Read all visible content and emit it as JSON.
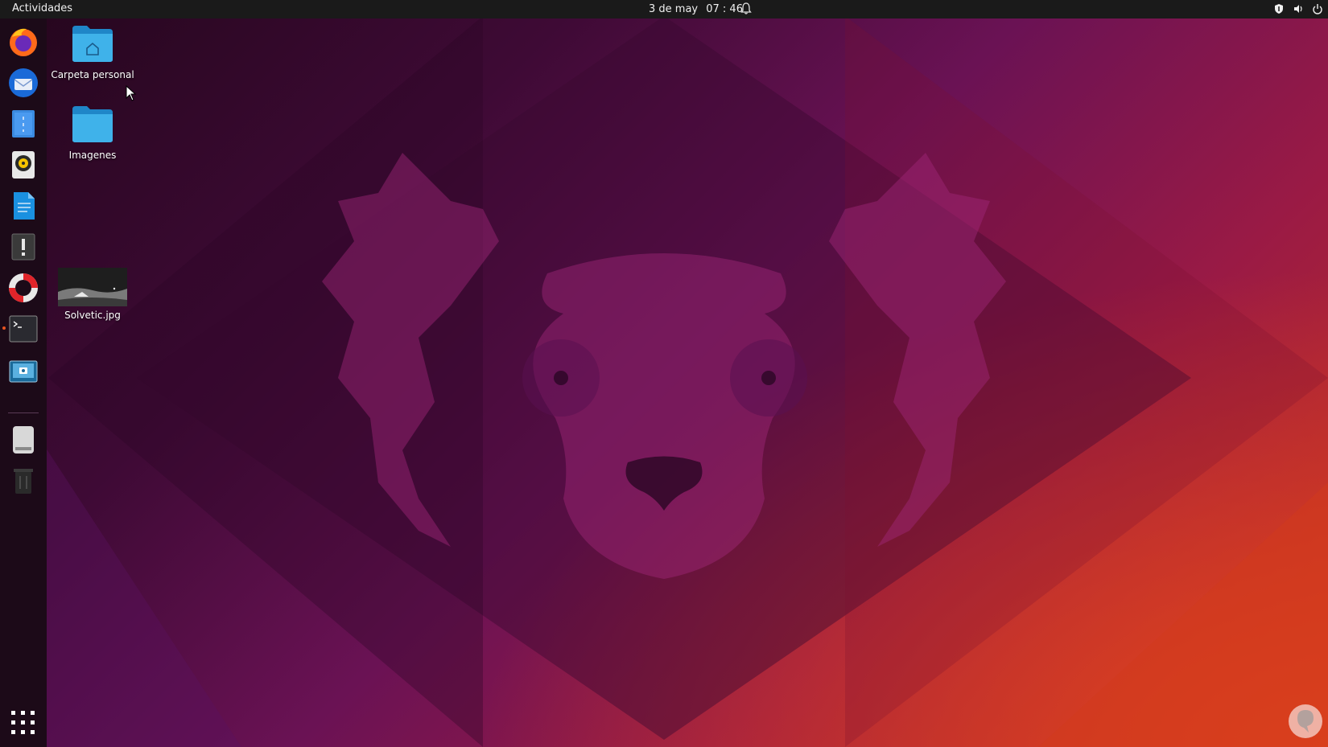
{
  "topbar": {
    "activities": "Actividades",
    "date": "3 de may",
    "time": "07 : 46",
    "tray_icons": [
      "shield-icon",
      "volume-icon",
      "power-icon"
    ]
  },
  "dock": {
    "apps": [
      {
        "name": "firefox-icon"
      },
      {
        "name": "thunderbird-icon"
      },
      {
        "name": "files-icon"
      },
      {
        "name": "rhythmbox-icon"
      },
      {
        "name": "writer-icon"
      },
      {
        "name": "software-updater-icon"
      },
      {
        "name": "help-icon"
      },
      {
        "name": "terminal-icon"
      },
      {
        "name": "screenshot-icon"
      },
      {
        "name": "drive-icon"
      },
      {
        "name": "trash-icon"
      }
    ],
    "show_apps": "grid-icon"
  },
  "desktop": {
    "icons": [
      {
        "label": "Carpeta personal"
      },
      {
        "label": "Imagenes"
      },
      {
        "label": "Solvetic.jpg"
      }
    ]
  },
  "colors": {
    "accent": "#e95420",
    "topbar": "#1a1a1a",
    "folder": "#2fa8e0"
  }
}
